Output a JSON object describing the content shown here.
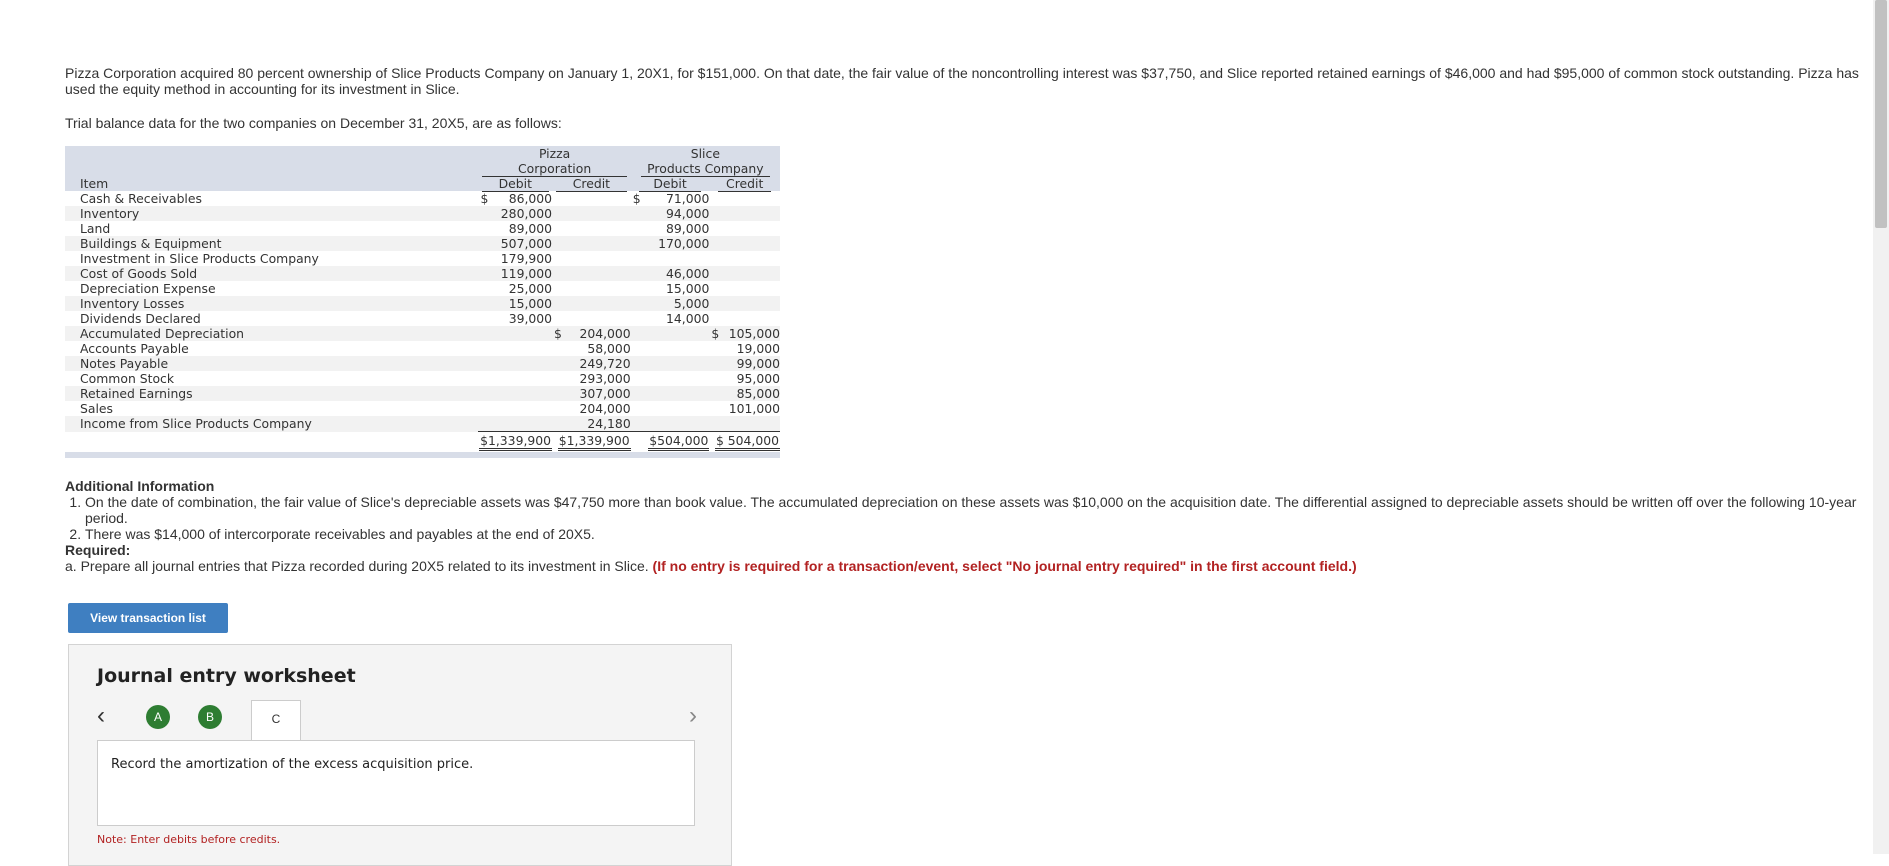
{
  "intro": "Pizza Corporation acquired 80 percent ownership of Slice Products Company on January 1, 20X1, for $151,000. On that date, the fair value of the noncontrolling interest was $37,750, and Slice reported retained earnings of $46,000 and had $95,000 of common stock outstanding. Pizza has used the equity method in accounting for its investment in Slice.",
  "trial_lead": "Trial balance data for the two companies on December 31, 20X5, are as follows:",
  "table": {
    "pizza_header_1": "Pizza",
    "pizza_header_2": "Corporation",
    "slice_header_1": "Slice",
    "slice_header_2": "Products Company",
    "item_header": "Item",
    "debit": "Debit",
    "credit": "Credit",
    "rows": [
      {
        "item": "Cash & Receivables",
        "pd": "86,000",
        "pc": "",
        "sd": "71,000",
        "sc": ""
      },
      {
        "item": "Inventory",
        "pd": "280,000",
        "pc": "",
        "sd": "94,000",
        "sc": ""
      },
      {
        "item": "Land",
        "pd": "89,000",
        "pc": "",
        "sd": "89,000",
        "sc": ""
      },
      {
        "item": "Buildings & Equipment",
        "pd": "507,000",
        "pc": "",
        "sd": "170,000",
        "sc": ""
      },
      {
        "item": "Investment in Slice Products Company",
        "pd": "179,900",
        "pc": "",
        "sd": "",
        "sc": ""
      },
      {
        "item": "Cost of Goods Sold",
        "pd": "119,000",
        "pc": "",
        "sd": "46,000",
        "sc": ""
      },
      {
        "item": "Depreciation Expense",
        "pd": "25,000",
        "pc": "",
        "sd": "15,000",
        "sc": ""
      },
      {
        "item": "Inventory Losses",
        "pd": "15,000",
        "pc": "",
        "sd": "5,000",
        "sc": ""
      },
      {
        "item": "Dividends Declared",
        "pd": "39,000",
        "pc": "",
        "sd": "14,000",
        "sc": ""
      },
      {
        "item": "Accumulated Depreciation",
        "pd": "",
        "pc": "204,000",
        "sd": "",
        "sc": "105,000"
      },
      {
        "item": "Accounts Payable",
        "pd": "",
        "pc": "58,000",
        "sd": "",
        "sc": "19,000"
      },
      {
        "item": "Notes Payable",
        "pd": "",
        "pc": "249,720",
        "sd": "",
        "sc": "99,000"
      },
      {
        "item": "Common Stock",
        "pd": "",
        "pc": "293,000",
        "sd": "",
        "sc": "95,000"
      },
      {
        "item": "Retained Earnings",
        "pd": "",
        "pc": "307,000",
        "sd": "",
        "sc": "85,000"
      },
      {
        "item": "Sales",
        "pd": "",
        "pc": "204,000",
        "sd": "",
        "sc": "101,000"
      },
      {
        "item": "Income from Slice Products Company",
        "pd": "",
        "pc": "24,180",
        "sd": "",
        "sc": ""
      }
    ],
    "totals": {
      "pd": "$1,339,900",
      "pc": "$1,339,900",
      "sd": "$504,000",
      "sc": "$ 504,000"
    }
  },
  "additional": {
    "title": "Additional Information",
    "items": [
      "On the date of combination, the fair value of Slice's depreciable assets was $47,750 more than book value. The accumulated depreciation on these assets was $10,000 on the acquisition date. The differential assigned to depreciable assets should be written off over the following 10-year period.",
      "There was $14,000 of intercorporate receivables and payables at the end of 20X5."
    ],
    "required_label": "Required:",
    "required_text": "a. Prepare all journal entries that Pizza recorded during 20X5 related to its investment in Slice.",
    "required_note": "(If no entry is required for a transaction/event, select \"No journal entry required\" in the first account field.)"
  },
  "button_label": "View transaction list",
  "worksheet": {
    "title": "Journal entry worksheet",
    "steps": [
      "A",
      "B",
      "C"
    ],
    "description": "Record the amortization of the excess acquisition price.",
    "note": "Note: Enter debits before credits."
  }
}
